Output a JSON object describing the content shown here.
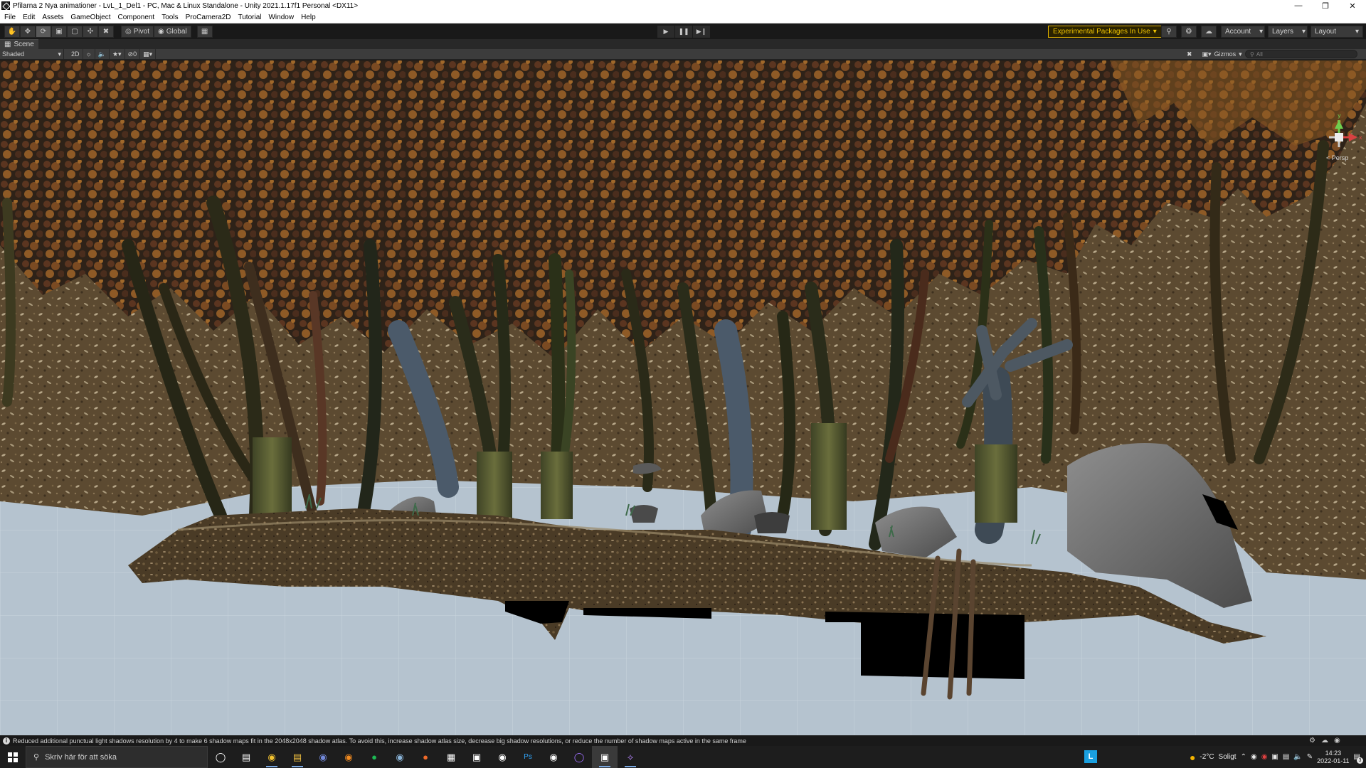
{
  "titlebar": {
    "title": "Pfilarna 2 Nya animationer - LvL_1_Del1 - PC, Mac & Linux Standalone - Unity 2021.1.17f1 Personal <DX11>"
  },
  "menu": [
    "File",
    "Edit",
    "Assets",
    "GameObject",
    "Component",
    "Tools",
    "ProCamera2D",
    "Tutorial",
    "Window",
    "Help"
  ],
  "toolbar": {
    "pivot_label": "Pivot",
    "global_label": "Global",
    "experimental_label": "Experimental Packages In Use",
    "account_label": "Account",
    "layers_label": "Layers",
    "layout_label": "Layout"
  },
  "scene": {
    "tab_label": "Scene",
    "shading_label": "Shaded",
    "mode_2d_label": "2D",
    "fx_count": "0",
    "gizmos_label": "Gizmos",
    "search_placeholder": "All",
    "persp_label": "< Persp",
    "axis_y": "y",
    "axis_x": "x"
  },
  "status": {
    "message": "Reduced additional punctual light shadows resolution by 4 to make 6 shadow maps fit in the 2048x2048 shadow atlas. To avoid this, increase shadow atlas size, decrease big shadow resolutions, or reduce the number of shadow maps active in the same frame"
  },
  "taskbar": {
    "search_placeholder": "Skriv här för att söka",
    "weather_temp": "-2°C",
    "weather_text": "Soligt",
    "time": "14:23",
    "date": "2022-01-11",
    "notification_count": "3",
    "pinned_badge": "L"
  },
  "colors": {
    "accent_warning": "#f0c400",
    "editor_bg": "#191919",
    "panel_bg": "#3c3c3c",
    "ground_grid": "#b9c6d1"
  }
}
